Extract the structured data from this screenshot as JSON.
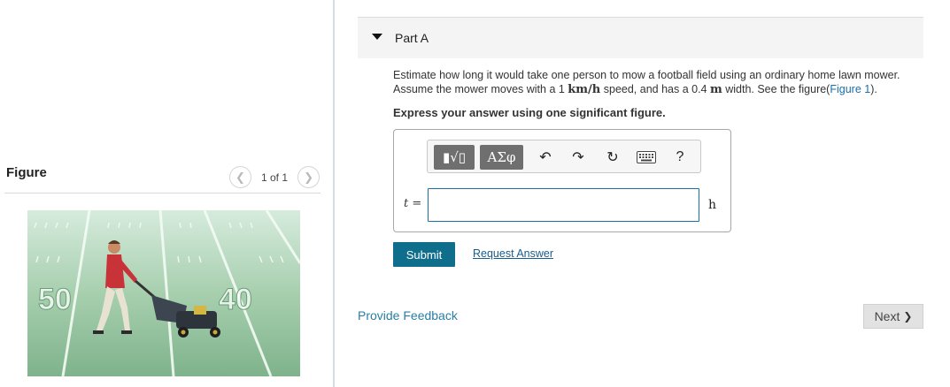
{
  "figure_panel": {
    "title": "Figure",
    "pager_text": "1 of 1",
    "image_numbers": [
      "50",
      "40"
    ]
  },
  "part": {
    "label": "Part A",
    "question_line1": "Estimate how long it would take one person to mow a football field using an ordinary home lawn mower.",
    "q2_a": "Assume the mower moves with a 1 ",
    "q2_unit1": "km/h",
    "q2_b": " speed, and has a 0.4 ",
    "q2_unit2": "m",
    "q2_c": " width. See the figure(",
    "q2_link": "Figure 1",
    "q2_d": ").",
    "instruction": "Express your answer using one significant figure."
  },
  "answer": {
    "toolbar": {
      "frac_label": "▮√▯",
      "greek_label": "ΑΣφ",
      "undo": "↶",
      "redo": "↷",
      "reset": "↻",
      "help": "?"
    },
    "variable": "t",
    "equals": "=",
    "value": "",
    "unit": "h"
  },
  "actions": {
    "submit": "Submit",
    "request_answer": "Request Answer",
    "provide_feedback": "Provide Feedback",
    "next": "Next",
    "next_icon": "❯"
  },
  "colors": {
    "accent": "#0e6e8c",
    "link": "#1a6fa8",
    "field_green": "#8fbf9a"
  }
}
